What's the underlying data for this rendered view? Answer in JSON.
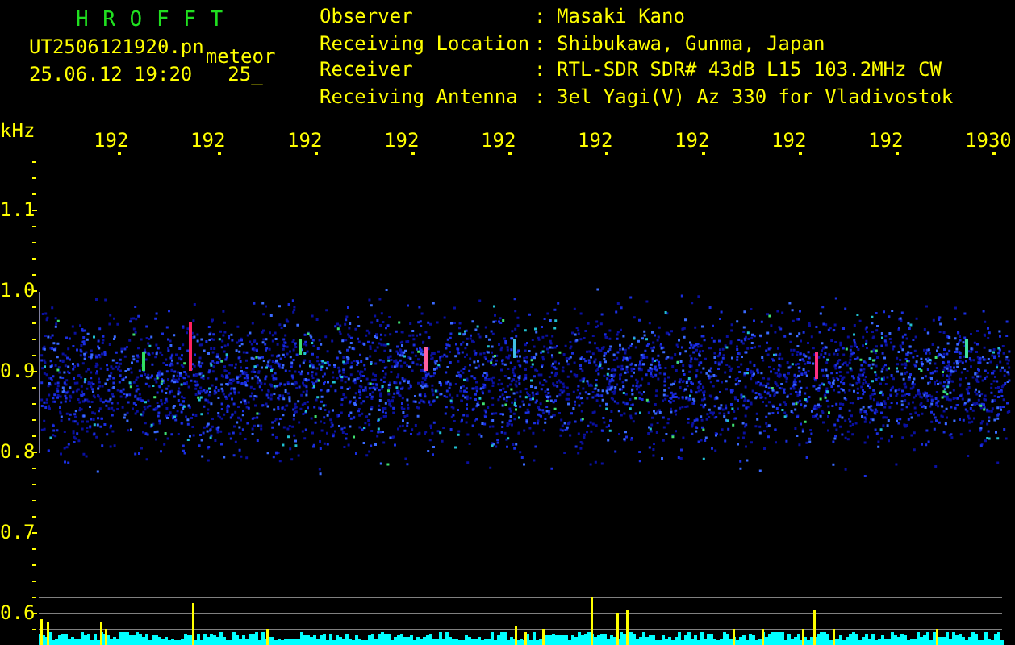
{
  "header": {
    "title": "H R O F F T",
    "filename": "UT2506121920.pn",
    "tag": "meteor",
    "datetime": "25.06.12 19:20",
    "count": "25_"
  },
  "info": [
    {
      "label": "Observer",
      "separator": ":",
      "value": "Masaki Kano"
    },
    {
      "label": "Receiving Location",
      "separator": ":",
      "value": "Shibukawa, Gunma, Japan"
    },
    {
      "label": "Receiver",
      "separator": ":",
      "value": "RTL-SDR SDR# 43dB L15 103.2MHz CW"
    },
    {
      "label": "Receiving Antenna",
      "separator": ":",
      "value": "3el Yagi(V) Az 330 for Vladivostok"
    }
  ],
  "plot": {
    "unit": "kHz",
    "x_labels": [
      "192",
      "192",
      "192",
      "192",
      "192",
      "192",
      "192",
      "192",
      "192",
      "1930"
    ],
    "y_labels": [
      "1.1",
      "1.0",
      "0.9",
      "0.8",
      "0.7",
      "0.6"
    ]
  }
}
